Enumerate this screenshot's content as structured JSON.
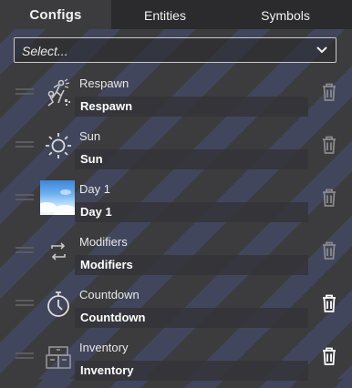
{
  "tabs": [
    {
      "label": "Configs",
      "active": true
    },
    {
      "label": "Entities",
      "active": false
    },
    {
      "label": "Symbols",
      "active": false
    }
  ],
  "select": {
    "value": "Select..."
  },
  "items": [
    {
      "title": "Respawn",
      "field_value": "Respawn",
      "icon": "respawn-icon",
      "trash_active": false
    },
    {
      "title": "Sun",
      "field_value": "Sun",
      "icon": "sun-icon",
      "trash_active": false
    },
    {
      "title": "Day 1",
      "field_value": "Day 1",
      "icon": "day-sky-thumbnail",
      "trash_active": false
    },
    {
      "title": "Modifiers",
      "field_value": "Modifiers",
      "icon": "swap-arrows-icon",
      "trash_active": false
    },
    {
      "title": "Countdown",
      "field_value": "Countdown",
      "icon": "stopwatch-icon",
      "trash_active": true
    },
    {
      "title": "Inventory",
      "field_value": "Inventory",
      "icon": "inventory-icon",
      "trash_active": true
    }
  ],
  "colors": {
    "trash_dim": "#8a8a8d",
    "trash_active": "#ffffff",
    "accent_stripe": "#464e76"
  }
}
